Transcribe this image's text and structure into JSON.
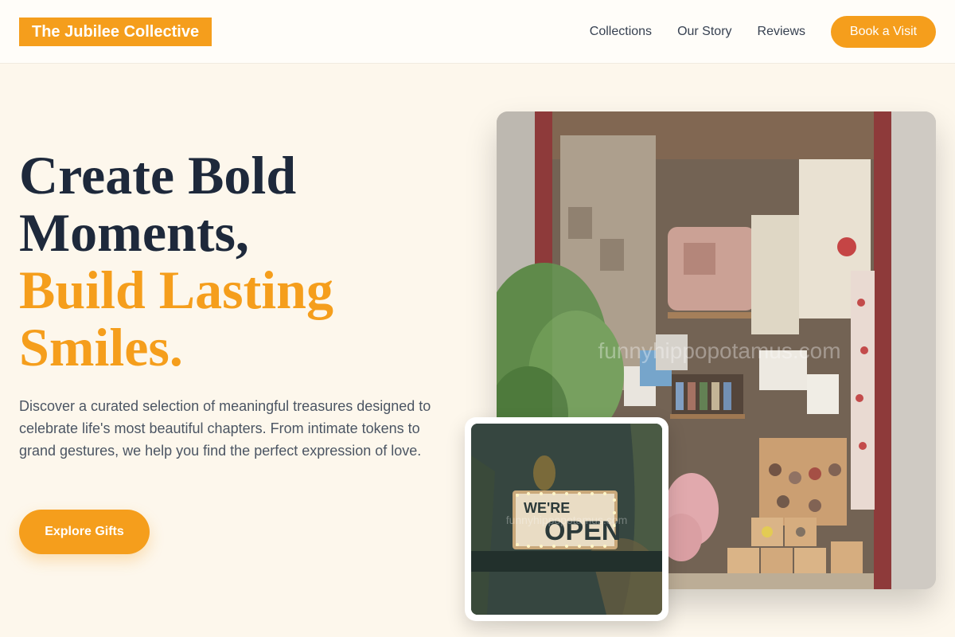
{
  "header": {
    "brand": "The Jubilee Collective",
    "nav": [
      {
        "label": "Collections"
      },
      {
        "label": "Our Story"
      },
      {
        "label": "Reviews"
      }
    ],
    "cta_label": "Book a Visit"
  },
  "hero": {
    "title_line1": "Create Bold",
    "title_line2": "Moments,",
    "title_line3": "Build Lasting",
    "title_line4": "Smiles.",
    "description": "Discover a curated selection of meaningful treasures designed to celebrate life's most beautiful chapters. From intimate tokens to grand gestures, we help you find the perfect expression of love.",
    "button_label": "Explore Gifts"
  },
  "images": {
    "shop_window_watermark": "funnyhippopotamus.com",
    "open_sign_line1": "WE'RE",
    "open_sign_line2": "OPEN",
    "open_sign_watermark": "funnyhippopotamus.com"
  },
  "colors": {
    "accent": "#f59e1c",
    "background": "#fdf7ec",
    "heading": "#1e293b",
    "body_text": "#4b5563"
  }
}
